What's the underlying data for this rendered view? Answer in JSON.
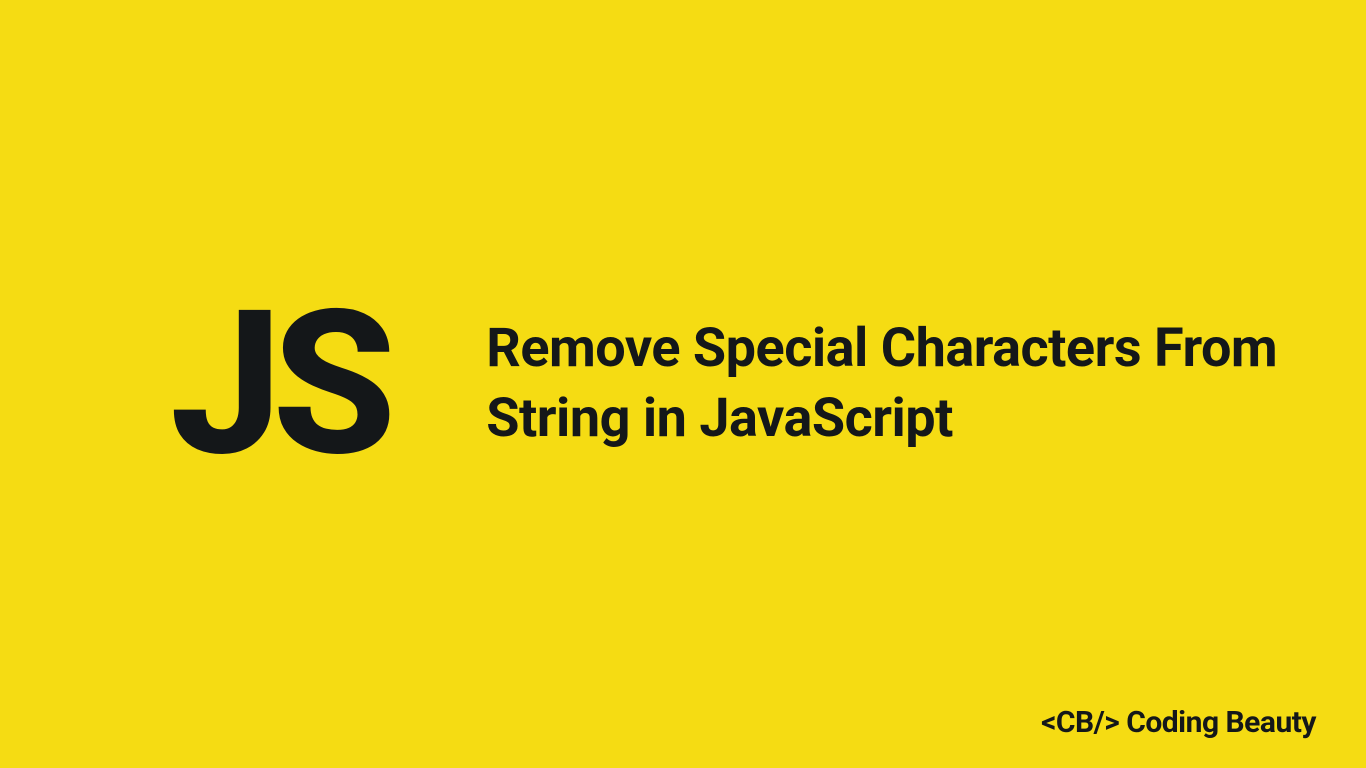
{
  "logo": {
    "letter_j": "J",
    "letter_s": "S"
  },
  "title": "Remove Special Characters From String in JavaScript",
  "footer": {
    "brand": "<CB/> Coding Beauty"
  },
  "colors": {
    "background": "#f5dc13",
    "text": "#141719"
  }
}
